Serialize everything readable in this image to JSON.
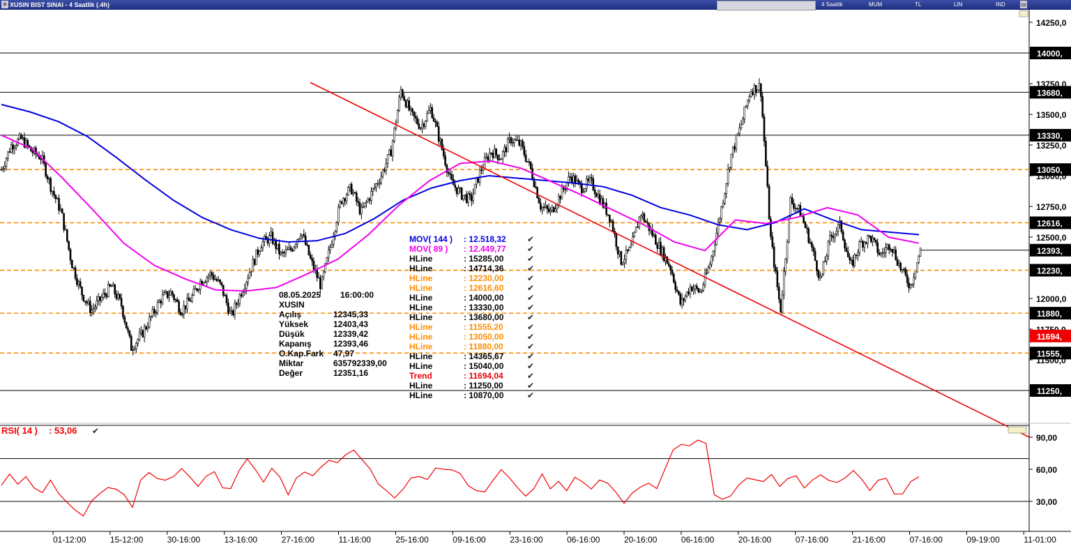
{
  "window": {
    "title": "XUSIN BIST SINAI - 4 Saatlik (.4h)",
    "close_icon": "close-icon",
    "toolbar_icons": [
      "drawing-tools-icon",
      "color-icon",
      "save-icon",
      "settings-icon",
      "zoom-icon",
      "cursor-icon",
      "crosshair-icon"
    ],
    "buttons": [
      "4 Saatlik",
      "MUM",
      "TL",
      "LIN",
      "IND"
    ],
    "restore_icon": "restore-icon"
  },
  "colors": {
    "price_bars": "#000000",
    "mov144": "#0000e0",
    "mov89": "#ee00ee",
    "trend": "#ee0000",
    "hline_orange": "#ff8c00",
    "hline_black": "#000000",
    "rsi": "#ee0000",
    "price_tag_bg": "#000000",
    "current_tag_bg": "#000000",
    "trend_tag_bg": "#ee0000"
  },
  "chart_data": [
    {
      "type": "candlestick",
      "symbol": "XUSIN",
      "timeframe": "4 Saatlik",
      "ylim": [
        10870,
        14365
      ],
      "y_ticks": [
        "14250,0",
        "14000,",
        "13750,0",
        "13680,",
        "13500,0",
        "13330,",
        "13250,0",
        "13050,",
        "13000,0",
        "12750,0",
        "12616,",
        "12500,0",
        "12393,",
        "12230,",
        "12000,0",
        "11880,",
        "11750,0",
        "11694,",
        "11555,",
        "11500,0",
        "11250,"
      ],
      "x_ticks": [
        "01-12:00",
        "15-12:00",
        "30-16:00",
        "13-16:00",
        "27-16:00",
        "11-16:00",
        "25-16:00",
        "09-16:00",
        "23-16:00",
        "06-16:00",
        "20-16:00",
        "06-16:00",
        "20-16:00",
        "07-16:00",
        "21-16:00",
        "07-16:00",
        "09-19:00",
        "11-01:00"
      ],
      "close_path": [
        13050,
        13250,
        13300,
        13200,
        13150,
        12900,
        12700,
        12300,
        12050,
        11900,
        12000,
        12100,
        11950,
        11600,
        11700,
        11850,
        12000,
        12050,
        11900,
        12000,
        12150,
        12200,
        12100,
        11850,
        12050,
        12250,
        12450,
        12500,
        12350,
        12400,
        12550,
        12300,
        12100,
        12450,
        12800,
        12900,
        12700,
        12850,
        13000,
        13200,
        13700,
        13500,
        13400,
        13550,
        13250,
        12950,
        12850,
        12800,
        13050,
        13200,
        13150,
        13300,
        13250,
        13050,
        12750,
        12700,
        12850,
        13000,
        12900,
        12950,
        12800,
        12650,
        12300,
        12400,
        12700,
        12550,
        12400,
        12250,
        11950,
        12100,
        12050,
        12300,
        12700,
        13150,
        13400,
        13700,
        13730,
        12500,
        11900,
        12800,
        12700,
        12450,
        12150,
        12500,
        12600,
        12250,
        12450,
        12500,
        12350,
        12450,
        12250,
        12100,
        12393
      ],
      "indicators": [
        {
          "name": "MOV( 144 )",
          "value": "12.518,32",
          "color": "#0000e0",
          "values": [
            13580,
            13520,
            13440,
            13320,
            13150,
            12970,
            12800,
            12660,
            12560,
            12490,
            12460,
            12470,
            12530,
            12650,
            12800,
            12900,
            12960,
            13000,
            12980,
            12960,
            12940,
            12910,
            12840,
            12740,
            12680,
            12600,
            12560,
            12620,
            12730,
            12640,
            12560,
            12540,
            12520
          ]
        },
        {
          "name": "MOV( 89 )",
          "value": "12.449,77",
          "color": "#ee00ee",
          "values": [
            13330,
            13220,
            12980,
            12720,
            12450,
            12270,
            12160,
            12070,
            12060,
            12090,
            12200,
            12320,
            12520,
            12760,
            12960,
            13100,
            13120,
            13060,
            12950,
            12840,
            12720,
            12600,
            12460,
            12390,
            12640,
            12610,
            12660,
            12740,
            12680,
            12500,
            12450
          ]
        }
      ],
      "hlines": [
        {
          "label": "HLine",
          "value": "15285,00",
          "color": "#000000"
        },
        {
          "label": "HLine",
          "value": "14714,36",
          "color": "#000000"
        },
        {
          "label": "HLine",
          "value": "12230,00",
          "color": "#ff8c00",
          "price": 12230
        },
        {
          "label": "HLine",
          "value": "12616,60",
          "color": "#ff8c00",
          "price": 12616.6
        },
        {
          "label": "HLine",
          "value": "14000,00",
          "color": "#000000",
          "price": 14000
        },
        {
          "label": "HLine",
          "value": "13330,00",
          "color": "#000000",
          "price": 13330
        },
        {
          "label": "HLine",
          "value": "13680,00",
          "color": "#000000",
          "price": 13680
        },
        {
          "label": "HLine",
          "value": "11555,20",
          "color": "#ff8c00",
          "price": 11555.2
        },
        {
          "label": "HLine",
          "value": "13050,00",
          "color": "#ff8c00",
          "price": 13050
        },
        {
          "label": "HLine",
          "value": "11880,00",
          "color": "#ff8c00",
          "price": 11880
        },
        {
          "label": "HLine",
          "value": "14365,67",
          "color": "#000000"
        },
        {
          "label": "HLine",
          "value": "15040,00",
          "color": "#000000"
        },
        {
          "label": "Trend",
          "value": "11694,04",
          "color": "#ee0000"
        },
        {
          "label": "HLine",
          "value": "11250,00",
          "color": "#000000",
          "price": 11250
        },
        {
          "label": "HLine",
          "value": "10870,00",
          "color": "#000000"
        }
      ],
      "trend_line": {
        "from": 13760,
        "to": 11694.04,
        "color": "#ee0000"
      },
      "current_price": 12393.46,
      "price_tags": [
        {
          "text": "14000,",
          "price": 14000,
          "bg": "#000000"
        },
        {
          "text": "13680,",
          "price": 13680,
          "bg": "#000000"
        },
        {
          "text": "13330,",
          "price": 13330,
          "bg": "#000000"
        },
        {
          "text": "13050,",
          "price": 13050,
          "bg": "#000000"
        },
        {
          "text": "12616,",
          "price": 12616.6,
          "bg": "#000000"
        },
        {
          "text": "12393,",
          "price": 12393.46,
          "bg": "#000000"
        },
        {
          "text": "12230,",
          "price": 12230,
          "bg": "#000000"
        },
        {
          "text": "11880,",
          "price": 11880,
          "bg": "#000000"
        },
        {
          "text": "11694,",
          "price": 11694.04,
          "bg": "#ee0000"
        },
        {
          "text": "11555,",
          "price": 11555.2,
          "bg": "#000000"
        },
        {
          "text": "11250,",
          "price": 11250,
          "bg": "#000000"
        }
      ],
      "ohlc_box": {
        "date": "08.05.2025",
        "time": "16:00:00",
        "symbol": "XUSIN",
        "rows": [
          {
            "label": "Açılış",
            "value": "12345,33"
          },
          {
            "label": "Yüksek",
            "value": "12403,43"
          },
          {
            "label": "Düşük",
            "value": "12339,42"
          },
          {
            "label": "Kapanış",
            "value": "12393,46"
          },
          {
            "label": "O.Kap.Fark",
            "value": "47,97"
          },
          {
            "label": "Miktar",
            "value": "635792339,00"
          },
          {
            "label": "Değer",
            "value": "12351,16"
          }
        ]
      }
    },
    {
      "type": "line",
      "name": "RSI( 14 )",
      "value": "53,06",
      "color": "#ee0000",
      "ylim": [
        15,
        105
      ],
      "y_ticks": [
        "90,00",
        "60,00",
        "30,00"
      ],
      "bands": [
        70,
        30
      ],
      "values": [
        45,
        54,
        48,
        52,
        42,
        40,
        48,
        38,
        30,
        20,
        18,
        30,
        36,
        45,
        40,
        36,
        26,
        48,
        58,
        52,
        48,
        55,
        60,
        52,
        46,
        52,
        58,
        44,
        40,
        60,
        70,
        58,
        50,
        60,
        52,
        38,
        50,
        58,
        55,
        60,
        70,
        66,
        72,
        80,
        68,
        60,
        48,
        38,
        34,
        42,
        50,
        55,
        50,
        60,
        62,
        58,
        56,
        46,
        38,
        40,
        50,
        58,
        54,
        42,
        34,
        44,
        54,
        42,
        50,
        38,
        54,
        48,
        40,
        52,
        46,
        38,
        30,
        36,
        44,
        48,
        40,
        62,
        78,
        82,
        84,
        86,
        84,
        38,
        30,
        36,
        46,
        50,
        52,
        48,
        54,
        46,
        50,
        54,
        44,
        48,
        56,
        50,
        46,
        54,
        58,
        50,
        42,
        48,
        52,
        38,
        35,
        50,
        53.06
      ]
    }
  ],
  "rsi_panel": {
    "label": "RSI( 14 )",
    "value": ": 53,06"
  }
}
